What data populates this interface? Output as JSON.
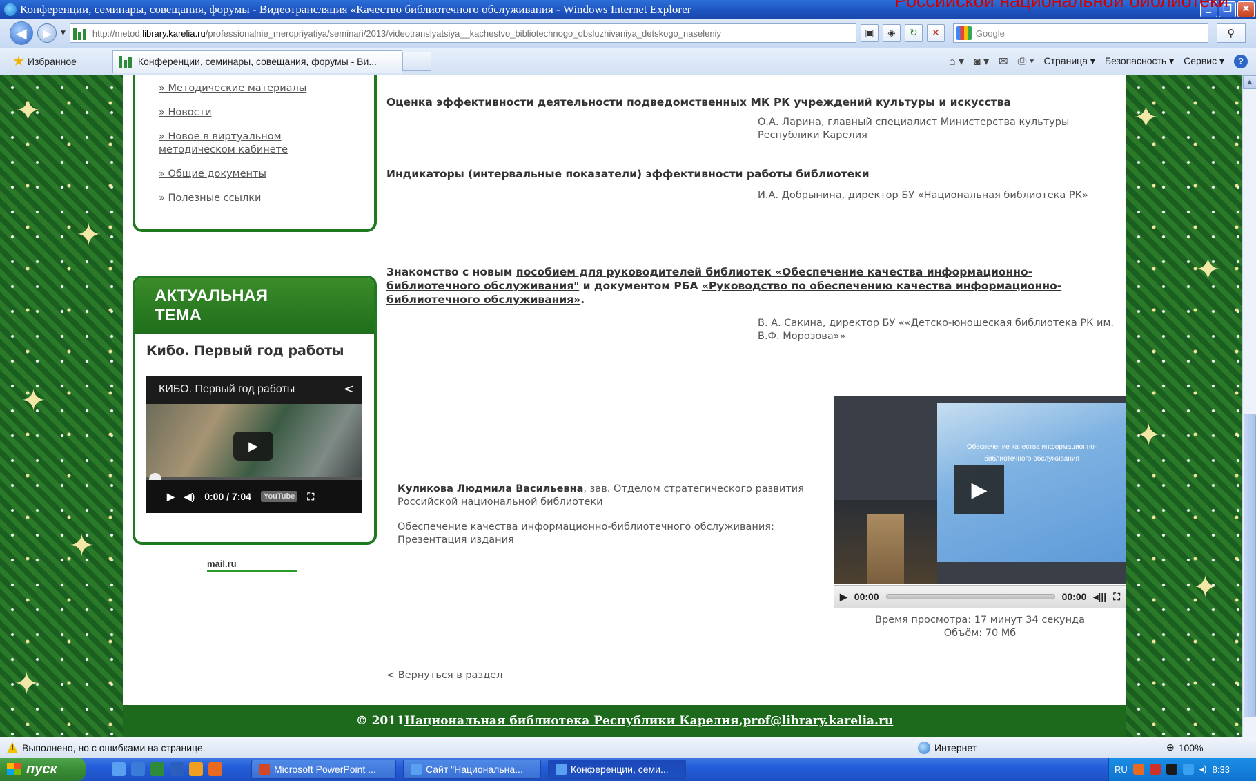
{
  "overlay_caption": "Российской национальной библиотеки",
  "window": {
    "title": "Конференции, семинары, совещания, форумы - Видеотрансляция «Качество библиотечного обслуживания - Windows Internet Explorer",
    "minimize": "_",
    "maximize": "❐",
    "close": "✕"
  },
  "address": {
    "url_prefix": "http://metod.",
    "url_host": "library.karelia.ru",
    "url_path": "/professionalnie_meropriyatiya/seminari/2013/videotranslyatsiya__kachestvo_bibliotechnogo_obsluzhivaniya_detskogo_naseleniy",
    "search_placeholder": "Google"
  },
  "favbar": {
    "favorites_label": "Избранное",
    "tab_title": "Конференции, семинары, совещания, форумы - Ви...",
    "page_menu": "Страница ▾",
    "security_menu": "Безопасность ▾",
    "service_menu": "Сервис ▾"
  },
  "sidebar": {
    "menu": [
      "» Методические материалы",
      "» Новости",
      "» Новое в виртуальном методическом кабинете",
      "» Общие документы",
      "» Полезные ссылки"
    ],
    "topic_heading_line1": "АКТУАЛЬНАЯ",
    "topic_heading_line2": "ТЕМА",
    "topic_title": "Кибо. Первый год работы",
    "yt_title": "КИБО. Первый год работы",
    "yt_time": "0:00 / 7:04",
    "yt_logo": "YouTube",
    "counter_label": "mail.ru"
  },
  "content": {
    "items": [
      {
        "title": "Оценка эффективности деятельности подведомственных МК РК учреждений культуры и искусства",
        "author": "О.А. Ларина, главный специалист Министерства культуры Республики Карелия"
      },
      {
        "title": "Индикаторы (интервальные показатели) эффективности работы библиотеки",
        "author": "И.А. Добрынина, директор БУ «Национальная библиотека РК»"
      }
    ],
    "third": {
      "prefix": "Знакомство с новым ",
      "link1": "пособием для руководителей библиотек «Обеспечение качества информационно-библиотечного обслуживания\"",
      "middle": " и документом РБА ",
      "link2": "«Руководство по обеспечению качества информационно-библиотечного обслуживания»",
      "suffix": ".",
      "author": "В. А. Сакина, директор БУ ««Детско-юношеская библиотека РК им. В.Ф. Морозова»»"
    },
    "speaker_name": "Куликова Людмила Васильевна",
    "speaker_role": ", зав. Отделом стратегического развития Российской национальной библиотеки",
    "presentation": "Обеспечение качества информационно-библиотечного обслуживания: Презентация издания",
    "video_slide_line1": "Обеспечение качества информационно-",
    "video_slide_line2": "библиотечного обслуживания",
    "video_time_current": "00:00",
    "video_time_total": "00:00",
    "view_time": "Время просмотра: 17 минут 34 секунда",
    "size": "Объём: 70 Мб",
    "back_link": "< Вернуться в раздел"
  },
  "footer": {
    "copyright": "© 2011 ",
    "org_link": "Национальная библиотека Республики Карелия",
    "separator": ", ",
    "email": "prof@library.karelia.ru"
  },
  "status": {
    "message": "Выполнено, но с ошибками на странице.",
    "zone": "Интернет",
    "zoom": "100%"
  },
  "taskbar": {
    "start": "пуск",
    "tasks": [
      "Microsoft PowerPoint ...",
      "Сайт \"Национальна...",
      "Конференции, семи..."
    ],
    "lang": "RU",
    "clock": "8:33"
  }
}
